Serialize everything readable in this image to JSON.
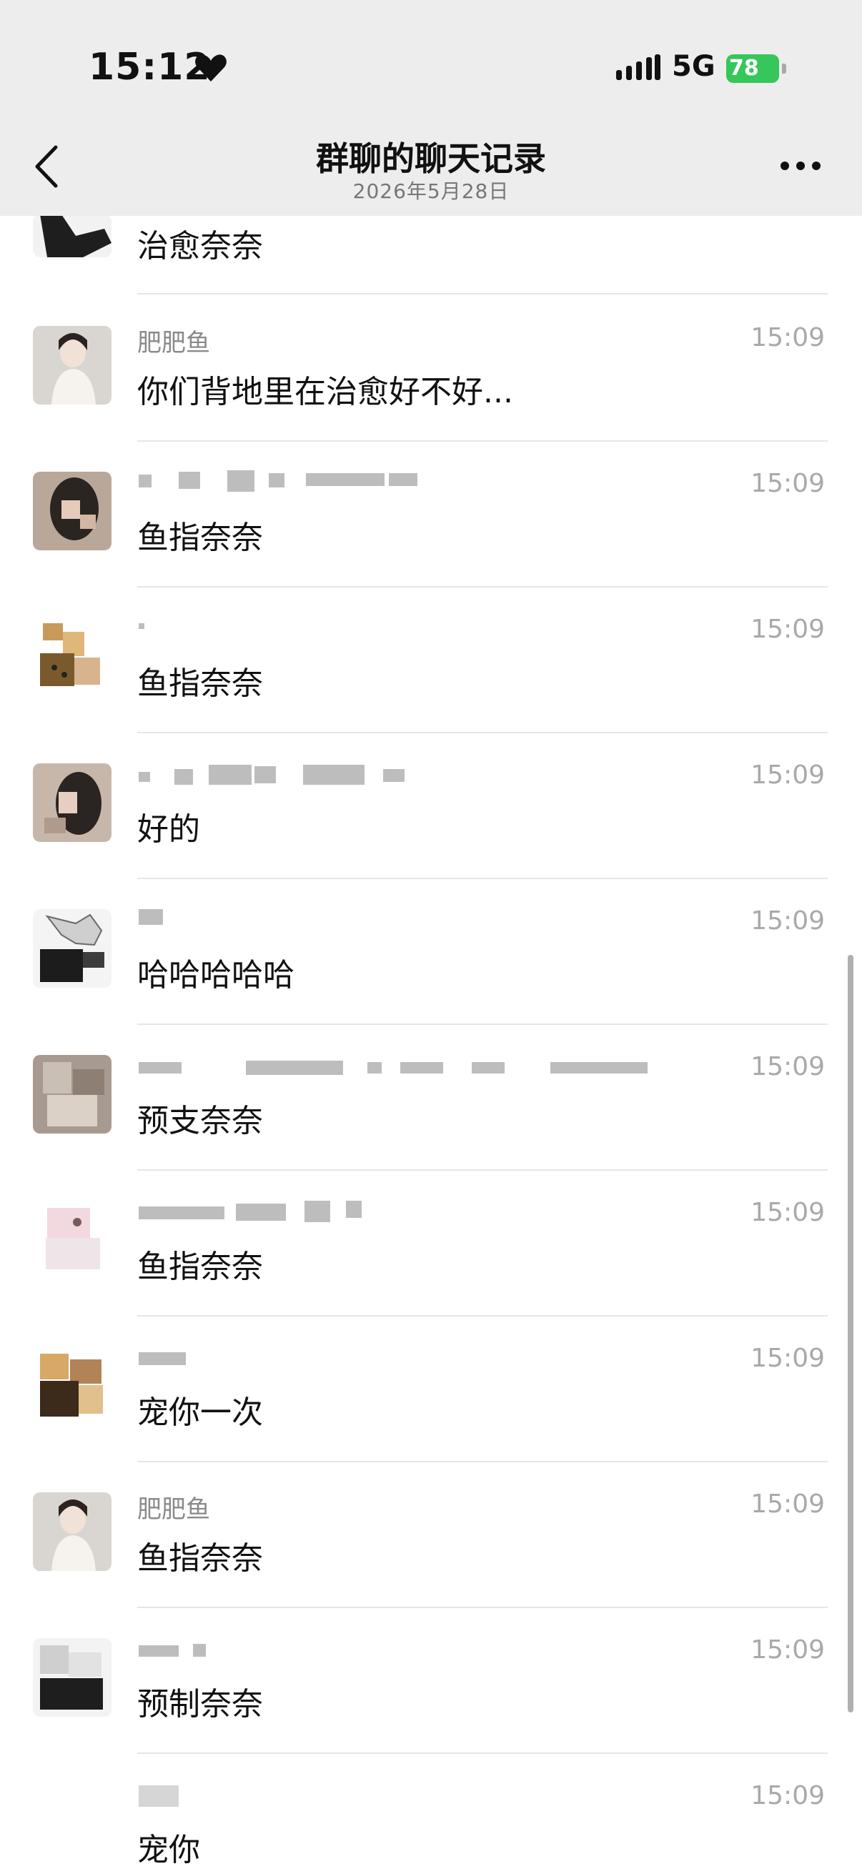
{
  "status_bar": {
    "time": "15:12",
    "network": "5G",
    "battery": "78"
  },
  "nav": {
    "title": "群聊的聊天记录",
    "subtitle": "2026年5月28日"
  },
  "messages": [
    {
      "sender": "",
      "time": "",
      "text": "治愈奈奈"
    },
    {
      "sender": "肥肥鱼",
      "time": "15:09",
      "text": "你们背地里在治愈好不好..."
    },
    {
      "sender": "",
      "time": "15:09",
      "text": "鱼指奈奈"
    },
    {
      "sender": "",
      "time": "15:09",
      "text": "鱼指奈奈"
    },
    {
      "sender": "",
      "time": "15:09",
      "text": "好的"
    },
    {
      "sender": "",
      "time": "15:09",
      "text": "哈哈哈哈哈"
    },
    {
      "sender": "",
      "time": "15:09",
      "text": "预支奈奈"
    },
    {
      "sender": "",
      "time": "15:09",
      "text": "鱼指奈奈"
    },
    {
      "sender": "",
      "time": "15:09",
      "text": "宠你一次"
    },
    {
      "sender": "肥肥鱼",
      "time": "15:09",
      "text": "鱼指奈奈"
    },
    {
      "sender": "",
      "time": "15:09",
      "text": "预制奈奈"
    },
    {
      "sender": "",
      "time": "15:09",
      "text": "宠你"
    }
  ],
  "colors": {
    "header_bg": "#ededed",
    "battery_green": "#35c759",
    "text_primary": "#111111",
    "text_secondary": "#8a8a8a",
    "time_gray": "#a9a9a9"
  }
}
